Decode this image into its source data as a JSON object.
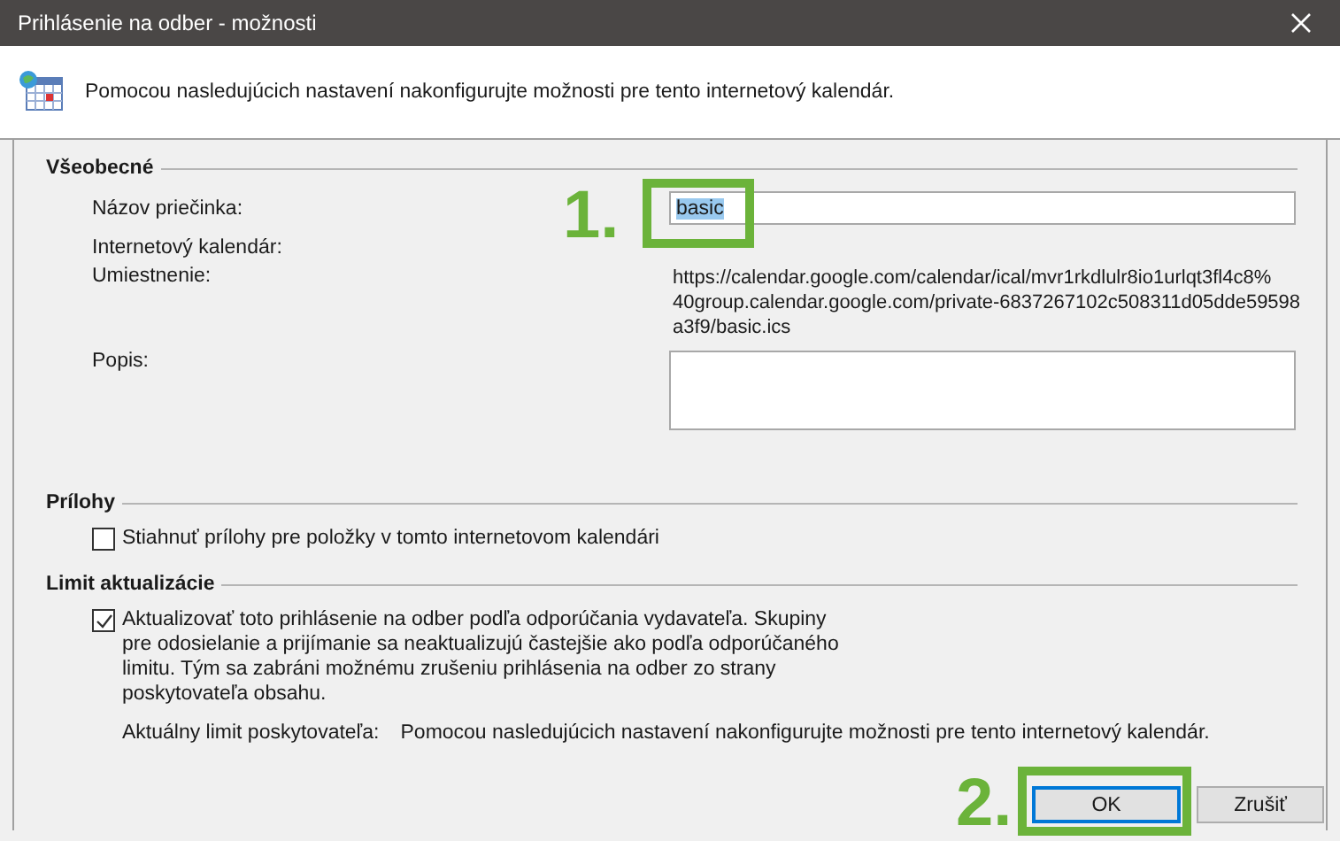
{
  "window": {
    "title": "Prihlásenie na odber - možnosti"
  },
  "intro": "Pomocou nasledujúcich nastavení nakonfigurujte možnosti pre tento internetový kalendár.",
  "general": {
    "heading": "Všeobecné",
    "folder_name": {
      "label": "Názov priečinka:",
      "value": "basic",
      "value_selected": true
    },
    "calendar_label": "Internetový kalendár:",
    "location": {
      "label": "Umiestnenie:",
      "lines": [
        "https://calendar.google.com/calendar/ical/mvr1rkdlulr8io1urlqt3fl4c8%",
        "40group.calendar.google.com/private-6837267102c508311d05dde59598",
        "a3f9/basic.ics"
      ]
    },
    "description": {
      "label": "Popis:"
    }
  },
  "attachments": {
    "heading": "Prílohy",
    "checkbox": {
      "label": "Stiahnuť prílohy pre položky v tomto internetovom kalendári",
      "checked": false
    }
  },
  "update_limit": {
    "heading": "Limit aktualizácie",
    "checkbox": {
      "label": "Aktualizovať toto prihlásenie na odber podľa odporúčania vydavateľa. Skupiny pre odosielanie a prijímanie sa neaktualizujú častejšie ako podľa odporúčaného limitu. Tým sa zabráni možnému zrušeniu prihlásenia na odber zo strany poskytovateľa obsahu.",
      "checked": true
    },
    "provider_limit": {
      "label": "Aktuálny limit poskytovateľa:",
      "value": "Pomocou nasledujúcich nastavení nakonfigurujte možnosti pre tento internetový kalendár."
    }
  },
  "buttons": [
    {
      "label": "OK",
      "default": true
    },
    {
      "label": "Zrušiť",
      "default": false
    }
  ],
  "annotations": [
    {
      "label": "1."
    },
    {
      "label": "2."
    }
  ]
}
